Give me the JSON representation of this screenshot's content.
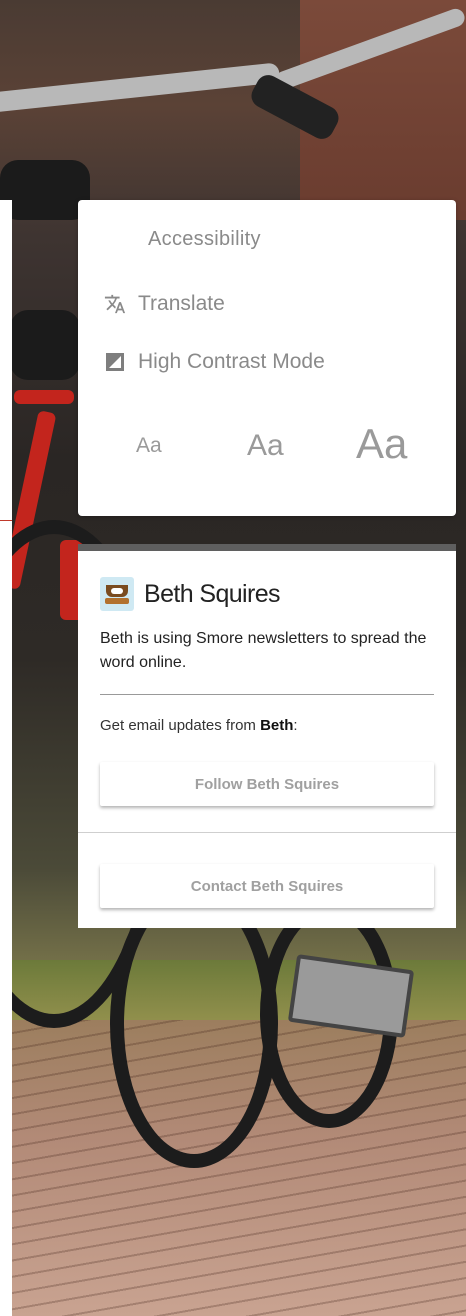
{
  "accessibility": {
    "title": "Accessibility",
    "translate_label": "Translate",
    "high_contrast_label": "High Contrast Mode",
    "text_size_small": "Aa",
    "text_size_medium": "Aa",
    "text_size_large": "Aa"
  },
  "profile": {
    "name": "Beth Squires",
    "bio": "Beth is using Smore newsletters to spread the word online.",
    "updates_prefix": "Get email updates from ",
    "updates_name": "Beth",
    "updates_suffix": ":",
    "follow_label": "Follow Beth Squires",
    "contact_label": "Contact Beth Squires"
  },
  "colors": {
    "panel_bg": "#ffffff",
    "muted_text": "#8a8a8a",
    "card_top_border": "#5f5f5f",
    "button_text": "#a0a0a0"
  },
  "icons": {
    "translate": "translate-icon",
    "contrast": "contrast-icon",
    "avatar": "avatar-icon"
  }
}
